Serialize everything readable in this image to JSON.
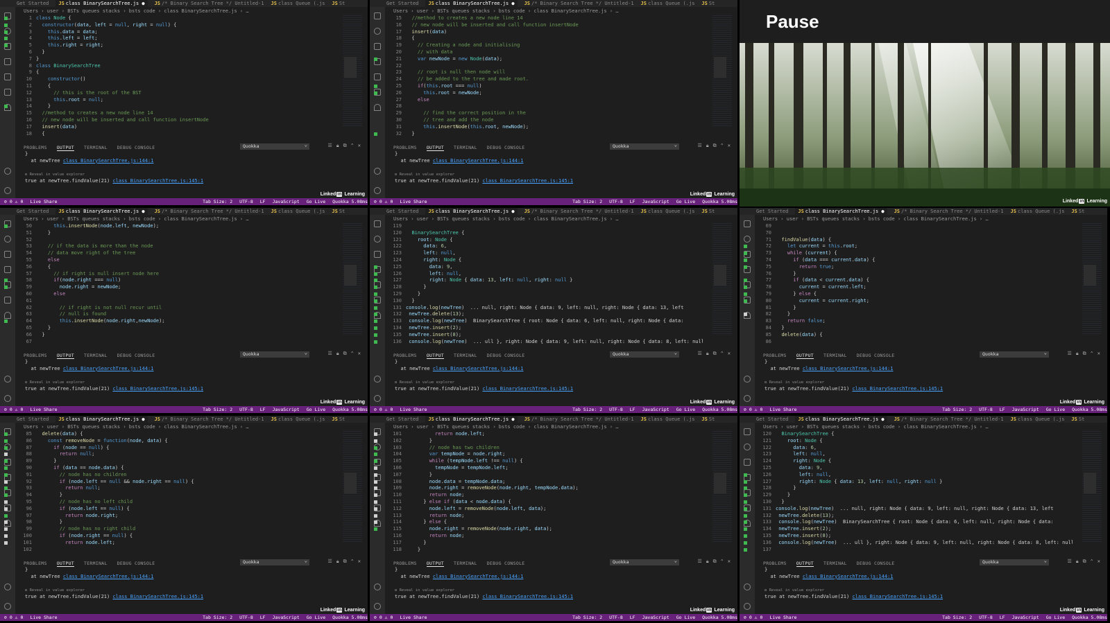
{
  "tabs": {
    "getting_started": "Get Started",
    "active": "class BinarySearchTree.js",
    "bst_tab": "/* Binary Search Tree */ Untitled-1",
    "queue_tab": "class Queue (.js",
    "st": "St"
  },
  "breadcrumb": {
    "p1": "Users",
    "p2": "user",
    "p3": "BSTs queues stacks",
    "p4": "bsts code",
    "p5": "class BinarySearchTree.js"
  },
  "panel_tabs": {
    "problems": "PROBLEMS",
    "output": "OUTPUT",
    "terminal": "TERMINAL",
    "debug": "DEBUG CONSOLE",
    "channel": "Quokka"
  },
  "output": {
    "l1": "}",
    "l2": "at newTree",
    "l3": "class BinarySearchTree.js:144:1",
    "l4": "Reveal in value explorer",
    "l5": "true at newTree.findValue(21)",
    "l6": "class BinarySearchTree.js:145:1"
  },
  "status": {
    "errors": "⊘ 0 ⚠ 0",
    "liveshare": "Live Share",
    "tabsize": "Tab Size: 2",
    "enc": "UTF-8",
    "eol": "LF",
    "lang": "JavaScript",
    "golive": "Go Live",
    "quokka": "Quokka 5.08ms"
  },
  "watermark": {
    "linked": "Linked",
    "in": "in",
    "learning": "Learning"
  },
  "pause_title": "Pause",
  "editors": [
    {
      "start": 1,
      "marks": "mmmmm........m....",
      "lines": [
        "<span class=k>class</span> <span class=t>Node</span> {",
        "  <span class=k>constructor</span>(<span class=v>data</span>, <span class=v>left</span> = <span class=k>null</span>, <span class=v>right</span> = <span class=k>null</span>) {",
        "    <span class=k>this</span>.<span class=v>data</span> = <span class=v>data</span>;",
        "    <span class=k>this</span>.<span class=v>left</span> = <span class=v>left</span>;",
        "    <span class=k>this</span>.<span class=v>right</span> = <span class=v>right</span>;",
        "  }",
        "}",
        "<span class=k>class</span> <span class=t>BinarySearchTree</span>",
        "{",
        "    <span class=k>constructor</span>()",
        "    {",
        "      <span class=c>// this is the root of the BST</span>",
        "      <span class=k>this</span>.<span class=v>root</span> = <span class=k>null</span>;",
        "    }",
        "  <span class=c>//method to creates a new node line 14</span>",
        "  <span class=c>// new node will be inserted and call function insertNode</span>",
        "  <span class=f>insert</span>(<span class=v>data</span>)",
        "  {"
      ]
    },
    {
      "start": 15,
      "marks": "......m...mm.....m",
      "lines": [
        "  <span class=c>//method to creates a new node line 14</span>",
        "  <span class=c>// new node will be inserted and call function insertNode</span>",
        "  <span class=f>insert</span>(<span class=v>data</span>)",
        "  {",
        "    <span class=c>// Creating a node and initialising</span>",
        "    <span class=c>// with data</span>",
        "    <span class=k>var</span> <span class=v>newNode</span> = <span class=k>new</span> <span class=t>Node</span>(<span class=v>data</span>);",
        "",
        "    <span class=c>// root is null then node will</span>",
        "    <span class=c>// be added to the tree and made root.</span>",
        "    <span class=p>if</span>(<span class=k>this</span>.<span class=v>root</span> === <span class=k>null</span>)",
        "      <span class=k>this</span>.<span class=v>root</span> = <span class=v>newNode</span>;",
        "    <span class=p>else</span>",
        "",
        "      <span class=c>// find the correct position in the</span>",
        "      <span class=c>// tree and add the node</span>",
        "      <span class=k>this</span>.<span class=f>insertNode</span>(<span class=k>this</span>.<span class=v>root</span>, <span class=v>newNode</span>);",
        "  }"
      ]
    },
    {
      "start": 50,
      "marks": "m.......mm....m...",
      "lines": [
        "      <span class=k>this</span>.<span class=f>insertNode</span>(<span class=v>node</span>.<span class=v>left</span>, <span class=v>newNode</span>);",
        "    }",
        "",
        "    <span class=c>// if the data is more than the node</span>",
        "    <span class=c>// data move right of the tree</span>",
        "    <span class=p>else</span>",
        "    {",
        "      <span class=c>// if right is null insert node here</span>",
        "      <span class=p>if</span>(<span class=v>node</span>.<span class=v>right</span> === <span class=k>null</span>)",
        "        <span class=v>node</span>.<span class=v>right</span> = <span class=v>newNode</span>;",
        "      <span class=p>else</span>",
        "",
        "        <span class=c>// if right is not null recur until</span>",
        "        <span class=c>// null is found</span>",
        "        <span class=k>this</span>.<span class=f>insertNode</span>(<span class=v>node</span>.<span class=v>right</span>,<span class=v>newNode</span>);",
        "    }",
        "  }",
        ""
      ]
    },
    {
      "start": 119,
      "marks": "......mmmmmmmmmmmm",
      "hover": true,
      "lines": [
        "",
        "  <span class=t>BinarySearchTree</span> {",
        "    <span class=v>root</span>: <span class=t>Node</span> {",
        "      <span class=v>data</span>: <span class=n>6</span>,",
        "      <span class=v>left</span>: <span class=k>null</span>,",
        "      <span class=v>right</span>: <span class=t>Node</span> {",
        "        <span class=v>data</span>: <span class=n>9</span>,",
        "        <span class=v>left</span>: <span class=k>null</span>,",
        "        <span class=v>right</span>: <span class=t>Node</span> { <span class=v>data</span>: <span class=n>13</span>, <span class=v>left</span>: <span class=k>null</span>, <span class=v>right</span>: <span class=k>null</span> }",
        "      }",
        "    }",
        "  }",
        "<span class=v>console</span>.<span class=f>log</span>(<span class=v>newTree</span>)  ... null, right: Node { data: 9, left: null, right: Node { data: 13, left",
        " <span class=v>newTree</span>.<span class=f>delete</span>(<span class=n>13</span>);",
        " <span class=v>console</span>.<span class=f>log</span>(<span class=v>newTree</span>)  BinarySearchTree { root: Node { data: 6, left: null, right: Node { data:",
        " <span class=v>newTree</span>.<span class=f>insert</span>(<span class=n>2</span>);",
        " <span class=v>newTree</span>.<span class=f>insert</span>(<span class=n>8</span>);",
        " <span class=v>console</span>.<span class=f>log</span>(<span class=v>newTree</span>)  ... ull }, right: Node { data: 9, left: null, right: Node { data: 8, left: null, right"
      ]
    },
    {
      "start": 69,
      "marks": "...mmmm.mmmm.w....",
      "lines": [
        "",
        "",
        "  <span class=f>findValue</span>(<span class=v>data</span>) {",
        "    <span class=k>let</span> <span class=v>current</span> = <span class=k>this</span>.<span class=v>root</span>;",
        "    <span class=p>while</span> (<span class=v>current</span>) {",
        "      <span class=p>if</span> (<span class=v>data</span> === <span class=v>current</span>.<span class=v>data</span>) {",
        "        <span class=p>return</span> <span class=k>true</span>;",
        "      }",
        "      <span class=p>if</span> (<span class=v>data</span> &lt; <span class=v>current</span>.<span class=v>data</span>) {",
        "        <span class=v>current</span> = <span class=v>current</span>.<span class=v>left</span>;",
        "      } <span class=p>else</span> {",
        "        <span class=v>current</span> = <span class=v>current</span>.<span class=v>right</span>;",
        "      }",
        "    }",
        "    <span class=p>return</span> <span class=k>false</span>;",
        "  }",
        "  <span class=f>delete</span>(<span class=v>data</span>) {",
        ""
      ]
    },
    {
      "start": 85,
      "marks": "mmmwmmmwmmwwmwwww.",
      "lines": [
        "  <span class=f>delete</span>(<span class=v>data</span>) {",
        "    <span class=k>const</span> <span class=f>removeNode</span> = <span class=k>function</span>(<span class=v>node</span>, <span class=v>data</span>) {",
        "      <span class=p>if</span> (<span class=v>node</span> == <span class=k>null</span>) {",
        "        <span class=p>return</span> <span class=k>null</span>;",
        "      }",
        "      <span class=p>if</span> (<span class=v>data</span> == <span class=v>node</span>.<span class=v>data</span>) {",
        "        <span class=c>// node has no children</span>",
        "        <span class=p>if</span> (<span class=v>node</span>.<span class=v>left</span> == <span class=k>null</span> &amp;&amp; <span class=v>node</span>.<span class=v>right</span> == <span class=k>null</span>) {",
        "          <span class=p>return</span> <span class=k>null</span>;",
        "        }",
        "        <span class=c>// node has no left child</span>",
        "        <span class=p>if</span> (<span class=v>node</span>.<span class=v>left</span> == <span class=k>null</span>) {",
        "          <span class=p>return</span> <span class=v>node</span>.<span class=v>right</span>;",
        "        }",
        "        <span class=c>// node has no right child</span>",
        "        <span class=p>if</span> (<span class=v>node</span>.<span class=v>right</span> == <span class=k>null</span>) {",
        "          <span class=p>return</span> <span class=v>node</span>.<span class=v>left</span>;",
        ""
      ]
    },
    {
      "start": 101,
      "marks": "wwmmmwwwwwwwwwm...",
      "lines": [
        "          <span class=p>return</span> <span class=v>node</span>.<span class=v>left</span>;",
        "        }",
        "        <span class=c>// node has two children</span>",
        "        <span class=k>var</span> <span class=v>tempNode</span> = <span class=v>node</span>.<span class=v>right</span>;",
        "        <span class=p>while</span> (<span class=v>tempNode</span>.<span class=v>left</span> !== <span class=k>null</span>) {",
        "          <span class=v>tempNode</span> = <span class=v>tempNode</span>.<span class=v>left</span>;",
        "        }",
        "        <span class=v>node</span>.<span class=v>data</span> = <span class=v>tempNode</span>.<span class=v>data</span>;",
        "        <span class=v>node</span>.<span class=v>right</span> = <span class=f>removeNode</span>(<span class=v>node</span>.<span class=v>right</span>, <span class=v>tempNode</span>.<span class=v>data</span>);",
        "        <span class=p>return</span> <span class=v>node</span>;",
        "      } <span class=p>else if</span> (<span class=v>data</span> &lt; <span class=v>node</span>.<span class=v>data</span>) {",
        "        <span class=v>node</span>.<span class=v>left</span> = <span class=f>removeNode</span>(<span class=v>node</span>.<span class=v>left</span>, <span class=v>data</span>);",
        "        <span class=p>return</span> <span class=v>node</span>;",
        "      } <span class=p>else</span> {",
        "        <span class=v>node</span>.<span class=v>right</span> = <span class=f>removeNode</span>(<span class=v>node</span>.<span class=v>right</span>, <span class=v>data</span>);",
        "        <span class=p>return</span> <span class=v>node</span>;",
        "      }",
        "    }"
      ]
    },
    {
      "start": 120,
      "marks": "......mmmmmmmmmmmm",
      "hover": true,
      "lines": [
        "  <span class=t>BinarySearchTree</span> {",
        "    <span class=v>root</span>: <span class=t>Node</span> {",
        "      <span class=v>data</span>: <span class=n>6</span>,",
        "      <span class=v>left</span>: <span class=k>null</span>,",
        "      <span class=v>right</span>: <span class=t>Node</span> {",
        "        <span class=v>data</span>: <span class=n>9</span>,",
        "        <span class=v>left</span>: <span class=k>null</span>,",
        "        <span class=v>right</span>: <span class=t>Node</span> { <span class=v>data</span>: <span class=n>13</span>, <span class=v>left</span>: <span class=k>null</span>, <span class=v>right</span>: <span class=k>null</span> }",
        "      }",
        "    }",
        "  }",
        "<span class=v>console</span>.<span class=f>log</span>(<span class=v>newTree</span>)  ... null, right: Node { data: 9, left: null, right: Node { data: 13, left",
        " <span class=v>newTree</span>.<span class=f>delete</span>(<span class=n>13</span>);",
        " <span class=v>console</span>.<span class=f>log</span>(<span class=v>newTree</span>)  BinarySearchTree { root: Node { data: 6, left: null, right: Node { data:",
        " <span class=v>newTree</span>.<span class=f>insert</span>(<span class=n>2</span>);",
        " <span class=v>newTree</span>.<span class=f>insert</span>(<span class=n>8</span>);",
        " <span class=v>console</span>.<span class=f>log</span>(<span class=v>newTree</span>)  ... ull }, right: Node { data: 9, left: null, right: Node { data: 8, left: null, right",
        ""
      ]
    }
  ]
}
